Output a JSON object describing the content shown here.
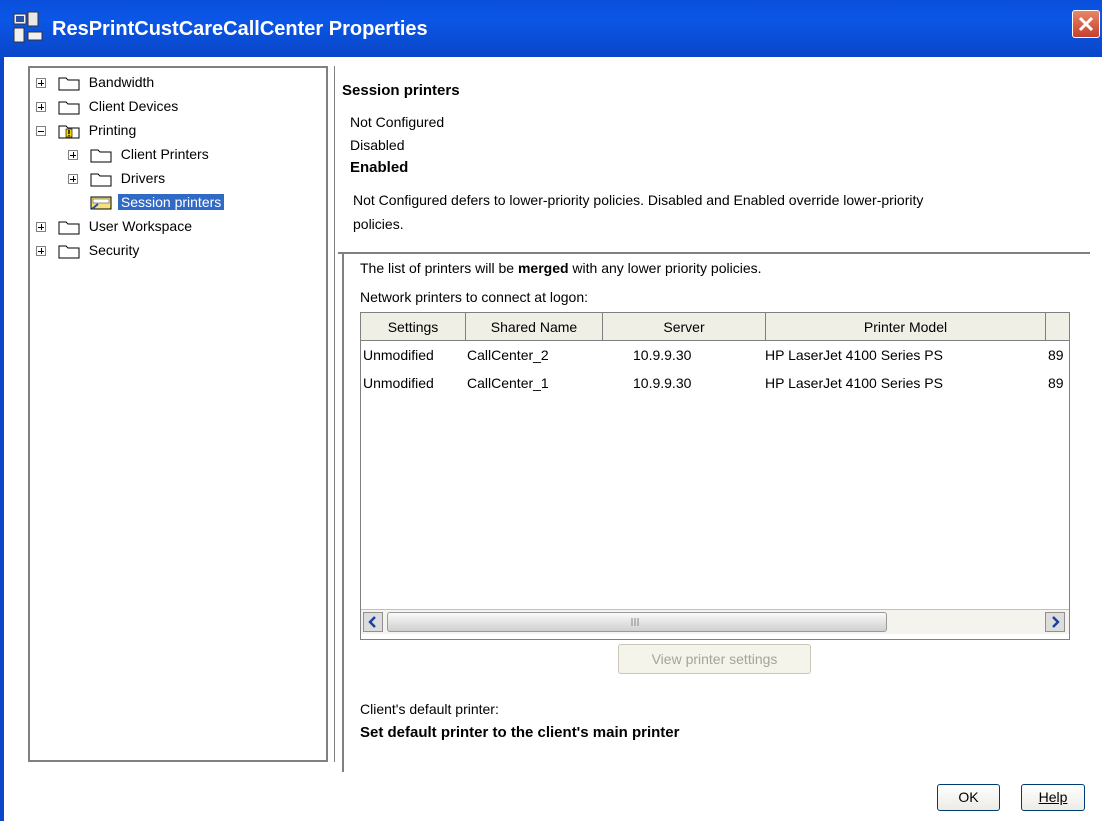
{
  "window": {
    "title": "ResPrintCustCareCallCenter Properties"
  },
  "tree": {
    "items": [
      {
        "label": "Bandwidth",
        "expander": "plus"
      },
      {
        "label": "Client Devices",
        "expander": "plus"
      },
      {
        "label": "Printing",
        "expander": "minus"
      },
      {
        "label": "Client Printers",
        "expander": "plus"
      },
      {
        "label": "Drivers",
        "expander": "plus"
      },
      {
        "label": "Session printers",
        "selected": true
      },
      {
        "label": "User Workspace",
        "expander": "plus"
      },
      {
        "label": "Security",
        "expander": "plus"
      }
    ]
  },
  "policy": {
    "heading": "Session printers",
    "options": [
      "Not Configured",
      "Disabled",
      "Enabled"
    ],
    "selected_option": "Enabled",
    "description_line1": "Not Configured defers to lower-priority policies. Disabled and Enabled override lower-priority",
    "description_line2": "policies."
  },
  "printers": {
    "merge_prefix": "The list of printers will be ",
    "merge_word": "merged",
    "merge_suffix": " with any lower priority policies.",
    "list_label": "Network printers to connect at logon:",
    "columns": [
      "Settings",
      "Shared Name",
      "Server",
      "Printer Model"
    ],
    "rows": [
      {
        "settings": "Unmodified",
        "shared_name": "CallCenter_2",
        "server": "10.9.9.30",
        "model": "HP LaserJet 4100 Series PS",
        "extra": "89"
      },
      {
        "settings": "Unmodified",
        "shared_name": "CallCenter_1",
        "server": "10.9.9.30",
        "model": "HP LaserJet 4100 Series PS",
        "extra": "89"
      }
    ],
    "view_settings_label": "View printer settings"
  },
  "default_printer": {
    "label": "Client's default printer:",
    "value": "Set default printer to the client's main printer"
  },
  "buttons": {
    "ok": "OK",
    "help": "Help"
  }
}
